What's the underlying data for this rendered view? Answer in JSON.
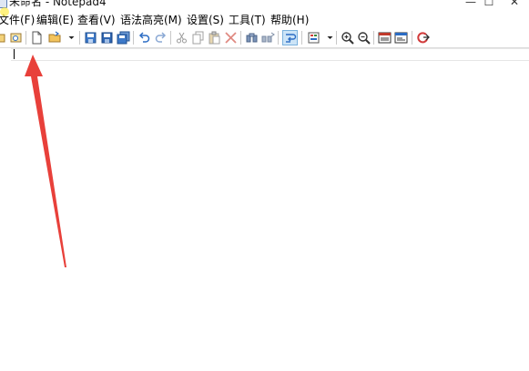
{
  "window": {
    "title": "未命名 - Notepad4",
    "minimize_glyph": "—",
    "maximize_glyph": "☐",
    "close_glyph": "✕"
  },
  "menu": [
    {
      "label": "文件(F)"
    },
    {
      "label": "编辑(E)"
    },
    {
      "label": "查看(V)"
    },
    {
      "label": "语法高亮(M)"
    },
    {
      "label": "设置(S)"
    },
    {
      "label": "工具(T)"
    },
    {
      "label": "帮助(H)"
    }
  ],
  "toolbar": {
    "icons": [
      "open-recent-icon",
      "find-file-icon",
      "new-file-icon",
      "open-folder-icon",
      "dropdown-arrow-icon",
      "save-icon",
      "save-as-icon",
      "save-copy-icon",
      "undo-icon",
      "redo-icon",
      "cut-icon",
      "copy-icon",
      "paste-icon",
      "delete-icon",
      "find-icon",
      "replace-icon",
      "word-wrap-icon",
      "scheme-icon",
      "dropdown-arrow-icon",
      "zoom-in-icon",
      "zoom-out-icon",
      "view-icon",
      "settings-icon",
      "exit-icon"
    ]
  },
  "editor": {
    "content": ""
  },
  "colors": {
    "annotation": "#e8403a",
    "accent": "#2b6cc4",
    "cursor_highlight": "#ffeb3c"
  }
}
